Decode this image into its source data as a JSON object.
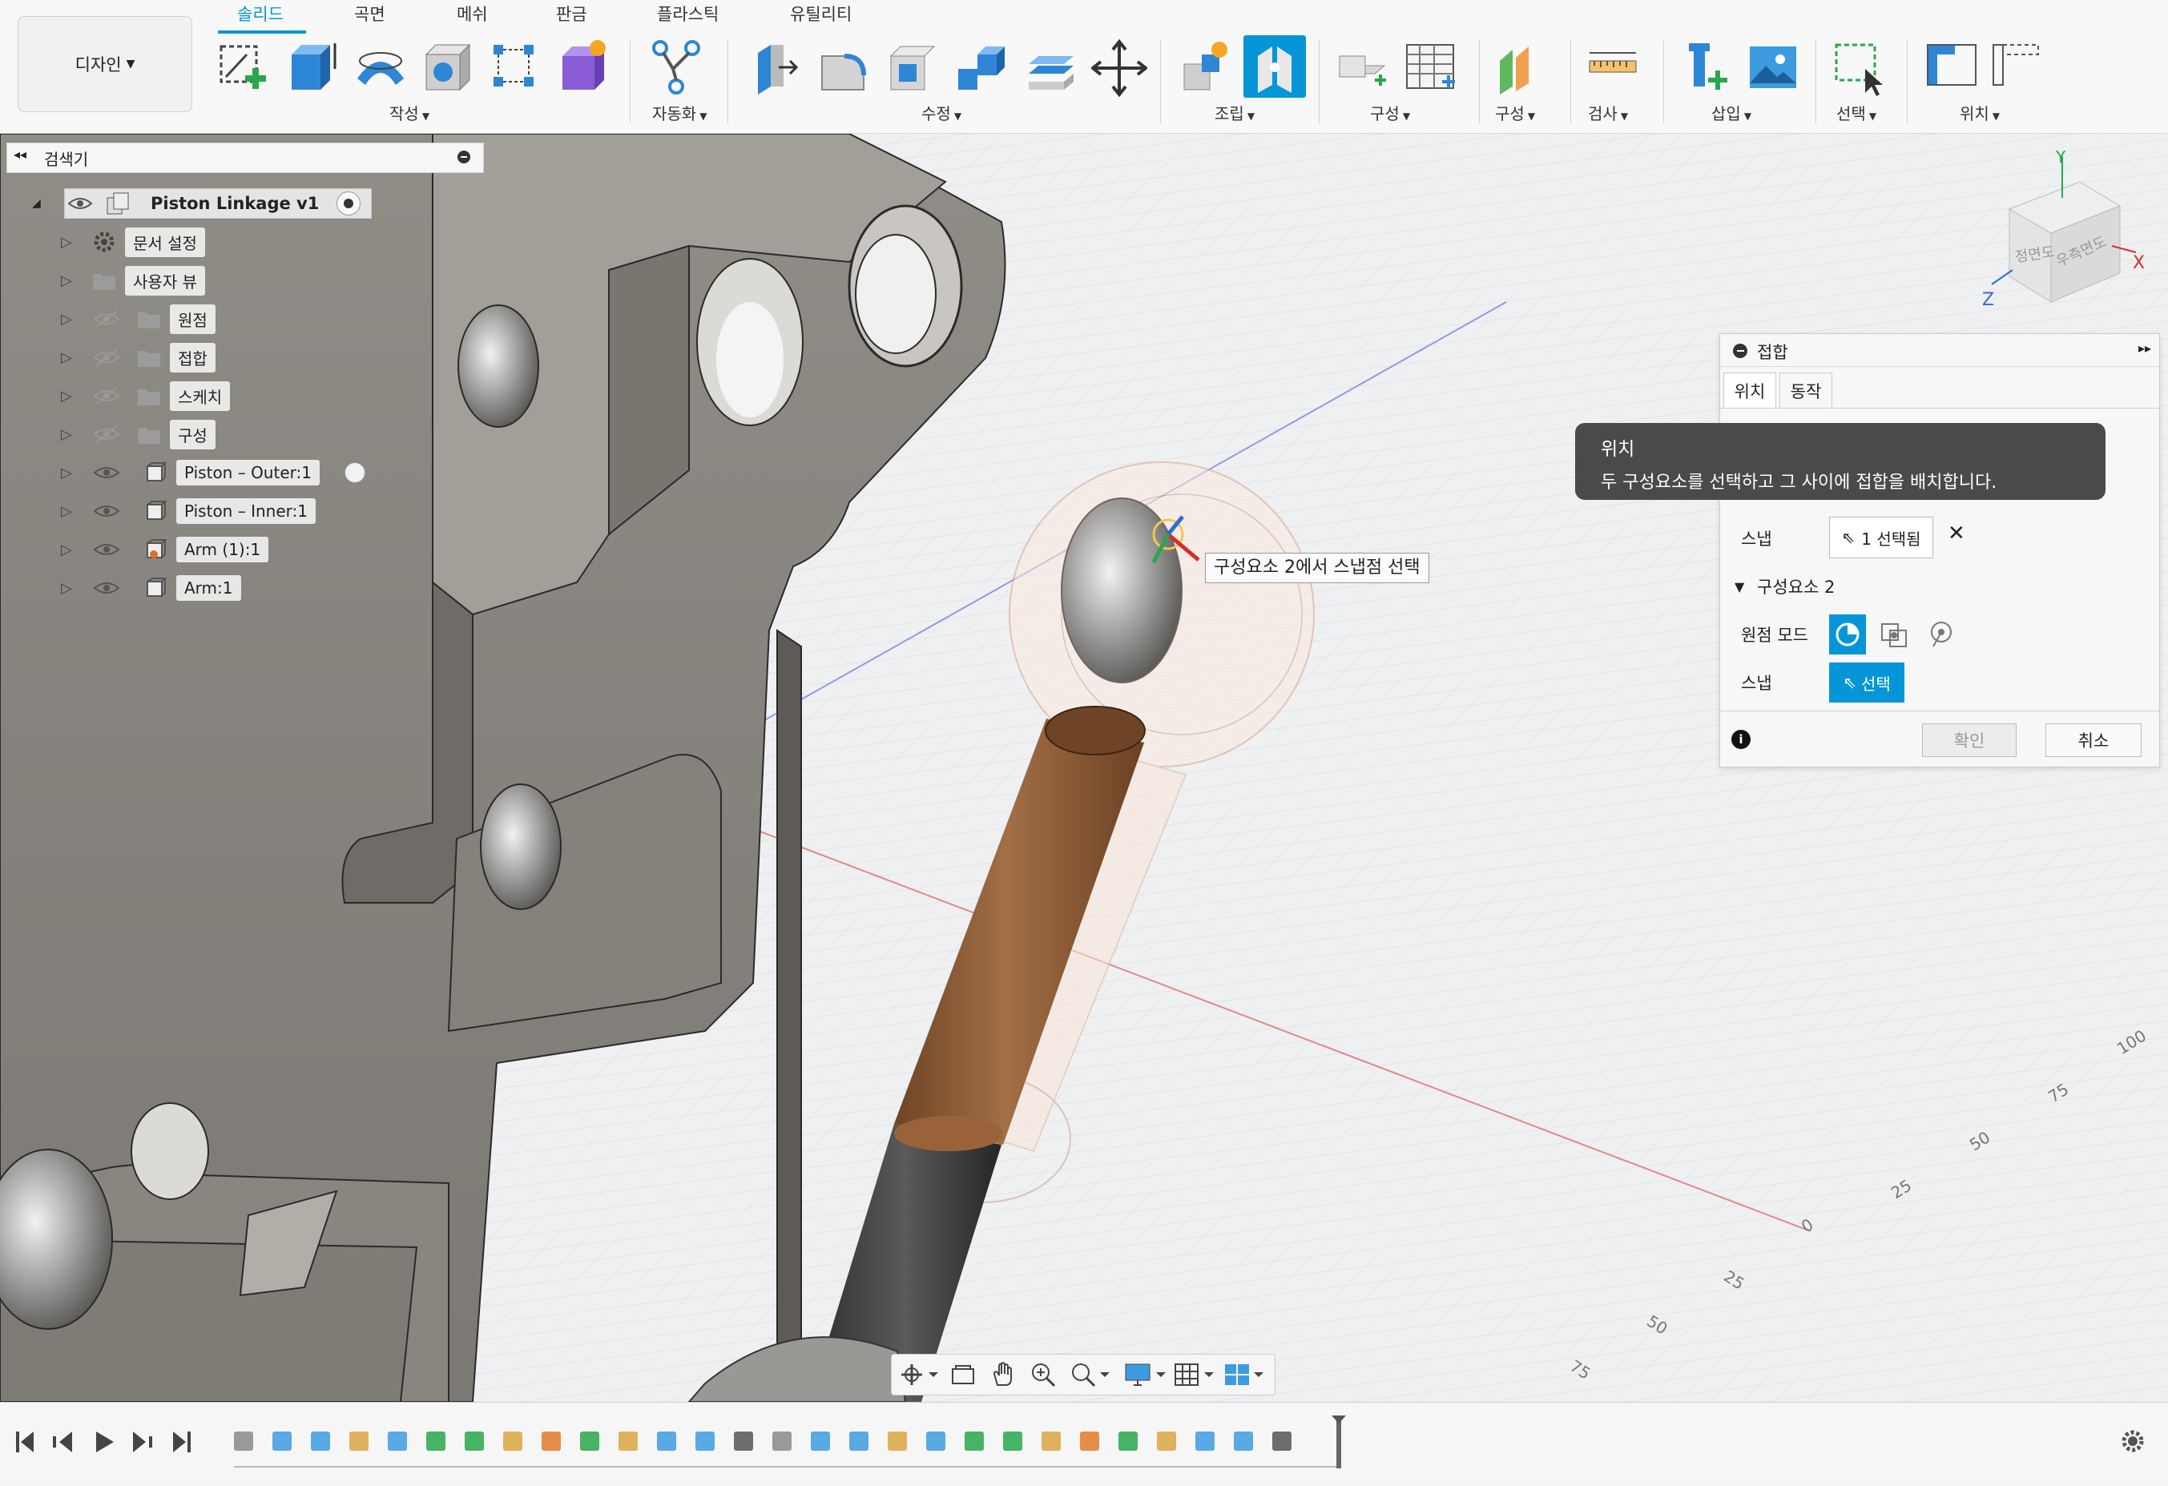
{
  "toolbar": {
    "workspace": "디자인",
    "tabs": [
      "솔리드",
      "곡면",
      "메쉬",
      "판금",
      "플라스틱",
      "유틸리티"
    ],
    "groups": {
      "create": "작성",
      "automate": "자동화",
      "modify": "수정",
      "assemble": "조립",
      "construct": "구성",
      "construct2": "구성",
      "inspect": "검사",
      "insert": "삽입",
      "select": "선택",
      "position": "위치"
    }
  },
  "browser": {
    "title": "검색기",
    "root": "Piston Linkage v1",
    "items": [
      {
        "label": "문서 설정",
        "icon": "gear-icon"
      },
      {
        "label": "사용자 뷰",
        "icon": "folder-icon"
      },
      {
        "label": "원점",
        "icon": "folder-icon"
      },
      {
        "label": "접합",
        "icon": "folder-icon"
      },
      {
        "label": "스케치",
        "icon": "folder-icon"
      },
      {
        "label": "구성",
        "icon": "folder-icon"
      },
      {
        "label": "Piston – Outer:1",
        "icon": "component-icon"
      },
      {
        "label": "Piston – Inner:1",
        "icon": "component-icon"
      },
      {
        "label": "Arm (1):1",
        "icon": "component-icon"
      },
      {
        "label": "Arm:1",
        "icon": "component-icon"
      }
    ]
  },
  "joint_panel": {
    "title": "접합",
    "tabs": [
      "위치",
      "동작"
    ],
    "snap_label": "스냅",
    "snap_selected": "1 선택됨",
    "component2_header": "구성요소 2",
    "origin_mode_label": "원점 모드",
    "snap2_label": "스냅",
    "select_button": "선택",
    "ok_button": "확인",
    "cancel_button": "취소"
  },
  "tooltip": {
    "title": "위치",
    "body": "두 구성요소를 선택하고 그 사이에 접합을 배치합니다."
  },
  "viewport": {
    "snap_tooltip": "구성요소 2에서 스냅점 선택",
    "viewcube": {
      "front": "정면도",
      "right": "우측면도",
      "x": "X",
      "y": "Y",
      "z": "Z"
    },
    "grid_labels": [
      "100",
      "75",
      "50",
      "25",
      "0",
      "25",
      "50",
      "75"
    ]
  },
  "colors": {
    "accent": "#0696d7",
    "panel_bg": "#f7f7f7",
    "tooltip_bg": "#4a4a4a",
    "part_grey": "#8d8a85",
    "wood": "#8a5b37"
  }
}
